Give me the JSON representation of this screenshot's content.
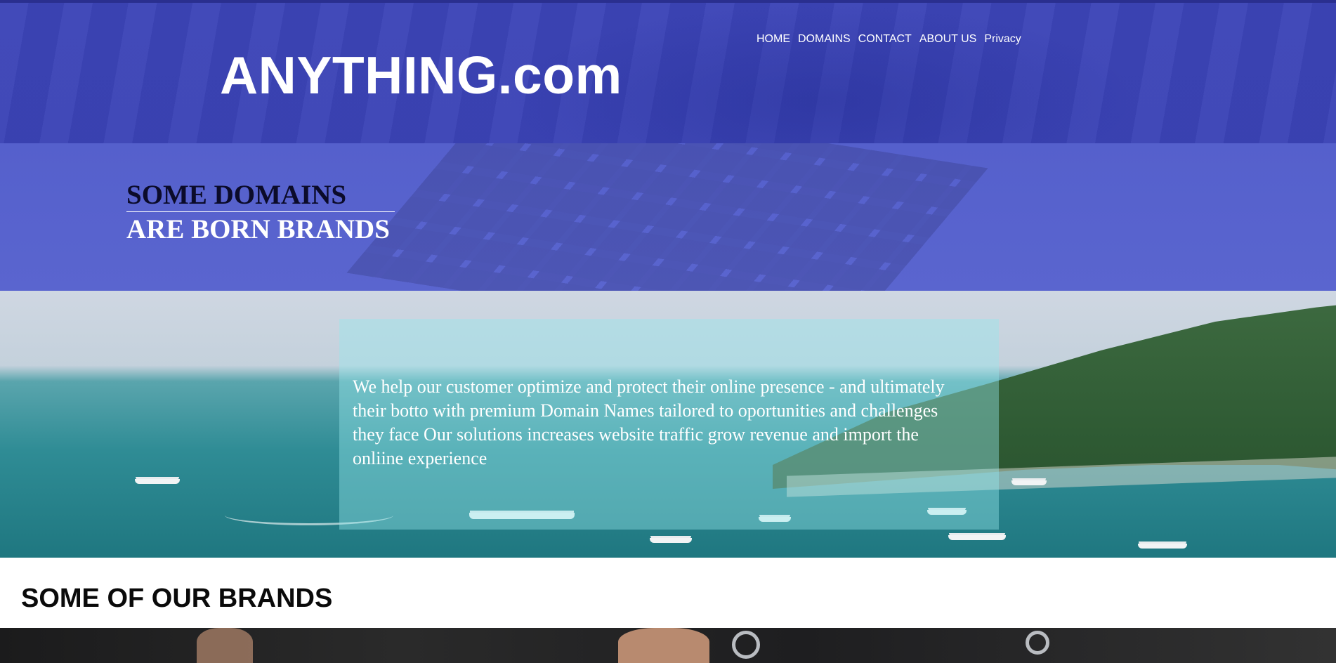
{
  "header": {
    "logo": "ANYTHING.com",
    "nav": [
      "HOME",
      "DOMAINS",
      "CONTACT",
      "ABOUT US",
      "Privacy"
    ]
  },
  "hero": {
    "line1": "SOME DOMAINS",
    "line2": "ARE BORN BRANDS"
  },
  "intro": {
    "text": "We help our customer optimize and protect their online presence - and ultimately their botto with premium Domain Names tailored to oportunities and challenges they face Our solutions increases website traffic grow revenue and import the onliine experience"
  },
  "brands": {
    "title": "SOME OF OUR BRANDS"
  },
  "colors": {
    "header_bg": "#3c44b7",
    "hero_bg": "#5560cc",
    "text_card": "#96e6eb"
  }
}
